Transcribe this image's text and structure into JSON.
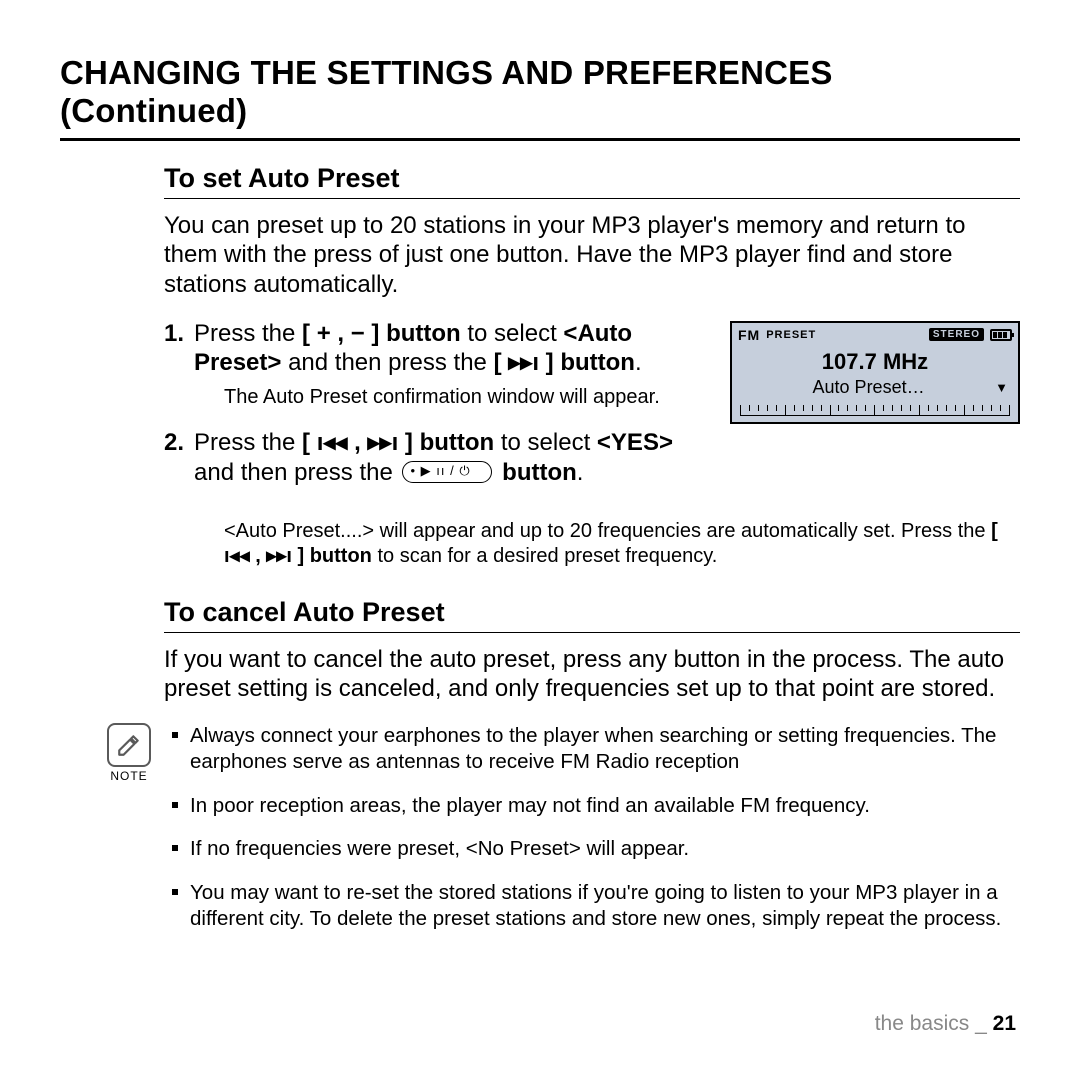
{
  "page_title": "CHANGING THE SETTINGS AND PREFERENCES (Continued)",
  "section1": {
    "heading": "To set Auto Preset",
    "intro": "You can preset up to 20 stations in your MP3 player's memory and return to them with the press of just one button. Have the MP3 player find and store stations automatically.",
    "step1_a": "Press the ",
    "step1_b_bold": "[ + , − ] button",
    "step1_c": " to select ",
    "step1_d_bold": "<Auto Preset>",
    "step1_e": " and then press the ",
    "step1_f_bold": "[ ▸▸ı ] button",
    "step1_g": ".",
    "step1_sub": "The Auto Preset confirmation window will appear.",
    "step2_a": "Press the ",
    "step2_b_bold": "[ ı◂◂ , ▸▸ı ] button",
    "step2_c": " to select ",
    "step2_d_bold": "<YES>",
    "step2_e": " and then press the ",
    "step2_f_bold": " button",
    "step2_g": ".",
    "post_a": "<Auto Preset....> will appear and up to 20 frequencies are automatically set. Press the ",
    "post_b_bold": "[ ı◂◂ , ▸▸ı ] button",
    "post_c": " to scan for a desired preset frequency."
  },
  "device": {
    "fm": "FM",
    "preset": "PRESET",
    "stereo": "STEREO",
    "freq": "107.7 MHz",
    "msg": "Auto Preset…"
  },
  "section2": {
    "heading": "To cancel Auto Preset",
    "para": "If you want to cancel the auto preset, press any button in the process. The auto preset setting is canceled, and only frequencies set up to that point are stored."
  },
  "note": {
    "label": "NOTE",
    "items": [
      "Always connect your earphones to the player when searching or setting frequencies. The earphones serve as antennas to receive FM Radio reception",
      "In poor reception areas, the player may not find an available FM frequency.",
      "If no frequencies were preset, <No Preset> will appear.",
      "You may want to re-set the stored stations if you're going to listen to your MP3 player in a different city. To delete the preset stations and store new ones, simply repeat the process."
    ]
  },
  "footer": {
    "section": "the basics",
    "sep": " _ ",
    "page": "21"
  }
}
